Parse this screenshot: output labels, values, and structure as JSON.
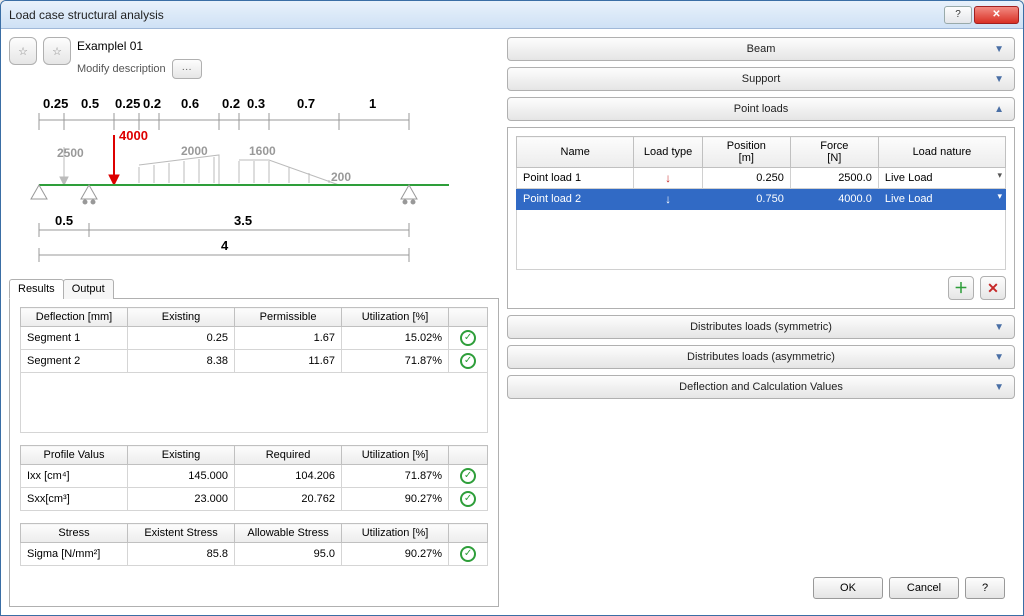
{
  "window": {
    "title": "Load case structural analysis"
  },
  "header": {
    "name": "Examplel 01",
    "modify": "Modify description"
  },
  "diagram": {
    "top_dims": [
      "0.25",
      "0.5",
      "0.25",
      "0.2",
      "0.6",
      "0.2",
      "0.3",
      "0.7",
      "1"
    ],
    "main_load": "4000",
    "loads": [
      "2500",
      "2000",
      "1600",
      "200"
    ],
    "bottom_dims": [
      "0.5",
      "3.5"
    ],
    "total": "4"
  },
  "tabs": {
    "results": "Results",
    "output": "Output"
  },
  "deflection": {
    "headers": [
      "Deflection [mm]",
      "Existing",
      "Permissible",
      "Utilization [%]"
    ],
    "rows": [
      {
        "label": "Segment 1",
        "existing": "0.25",
        "permissible": "1.67",
        "util": "15.02%"
      },
      {
        "label": "Segment 2",
        "existing": "8.38",
        "permissible": "11.67",
        "util": "71.87%"
      }
    ]
  },
  "profile": {
    "headers": [
      "Profile Valus",
      "Existing",
      "Required",
      "Utilization [%]"
    ],
    "rows": [
      {
        "label": "Ixx [cm⁴]",
        "existing": "145.000",
        "required": "104.206",
        "util": "71.87%"
      },
      {
        "label": "Sxx[cm³]",
        "existing": "23.000",
        "required": "20.762",
        "util": "90.27%"
      }
    ]
  },
  "stress": {
    "headers": [
      "Stress",
      "Existent Stress",
      "Allowable Stress",
      "Utilization [%]"
    ],
    "rows": [
      {
        "label": "Sigma [N/mm²]",
        "existing": "85.8",
        "allowable": "95.0",
        "util": "90.27%"
      }
    ]
  },
  "expanders": {
    "beam": "Beam",
    "support": "Support",
    "point_loads": "Point loads",
    "dist_sym": "Distributes loads (symmetric)",
    "dist_asym": "Distributes loads (asymmetric)",
    "deflection_calc": "Deflection and Calculation Values"
  },
  "point_loads": {
    "headers": {
      "name": "Name",
      "type": "Load type",
      "position": "Position\n[m]",
      "force": "Force\n[N]",
      "nature": "Load nature"
    },
    "rows": [
      {
        "name": "Point load 1",
        "type": "↓",
        "position": "0.250",
        "force": "2500.0",
        "nature": "Live Load",
        "selected": false
      },
      {
        "name": "Point load 2",
        "type": "↓",
        "position": "0.750",
        "force": "4000.0",
        "nature": "Live Load",
        "selected": true
      }
    ]
  },
  "buttons": {
    "ok": "OK",
    "cancel": "Cancel",
    "help": "?"
  }
}
